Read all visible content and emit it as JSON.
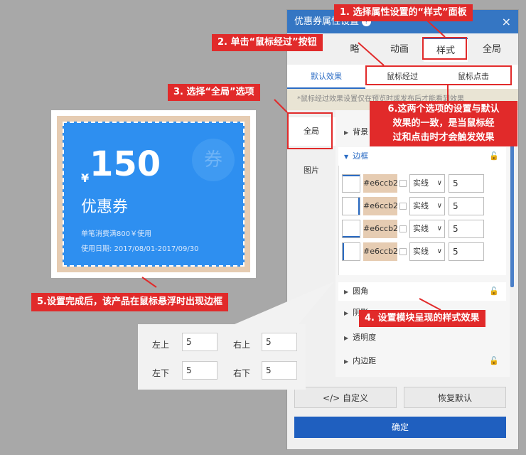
{
  "panel": {
    "title": "优惠券属性设置",
    "help_icon": "?",
    "close_icon": "×",
    "tabs": [
      "略",
      "动画",
      "样式",
      "全局"
    ],
    "subtabs": [
      "默认效果",
      "鼠标经过",
      "鼠标点击"
    ],
    "note": "*鼠标经过效果设置仅在预览时或发布后才能看到效果",
    "nav": [
      "全局",
      "图片"
    ],
    "groups": {
      "background": "背景",
      "border": "边框",
      "corner": "圆角",
      "shadow": "阴影",
      "opacity": "透明度",
      "padding": "内边距"
    },
    "border_rows": [
      {
        "color": "#e6ccb2",
        "style": "实线",
        "width": "5"
      },
      {
        "color": "#e6ccb2",
        "style": "实线",
        "width": "5"
      },
      {
        "color": "#e6ccb2",
        "style": "实线",
        "width": "5"
      },
      {
        "color": "#e6ccb2",
        "style": "实线",
        "width": "5"
      }
    ],
    "buttons": {
      "custom": "</> 自定义",
      "reset": "恢复默认",
      "ok": "确定"
    }
  },
  "coupon": {
    "yen": "¥",
    "value": "150",
    "title": "优惠券",
    "rule": "单笔消费满800￥使用",
    "date": "使用日期: 2017/08/01-2017/09/30",
    "badge": "券",
    "colors": {
      "background": "#2e8ff0",
      "border": "#e6ccb2"
    }
  },
  "radius_popup": {
    "top_left_label": "左上",
    "top_left": "5",
    "top_right_label": "右上",
    "top_right": "5",
    "bottom_left_label": "左下",
    "bottom_left": "5",
    "bottom_right_label": "右下",
    "bottom_right": "5"
  },
  "annotations": {
    "step1": "1. 选择属性设置的“样式”面板",
    "step2": "2. 单击“鼠标经过”按钮",
    "step3": "3. 选择“全局”选项",
    "step4": "4. 设置模块呈现的样式效果",
    "step5": "5.设置完成后，该产品在鼠标悬浮时出现边框",
    "step6_line1": "6.这两个选项的设置与默认",
    "step6_line2": "效果的一致，是当鼠标经",
    "step6_line3": "过和点击时才会触发效果"
  }
}
